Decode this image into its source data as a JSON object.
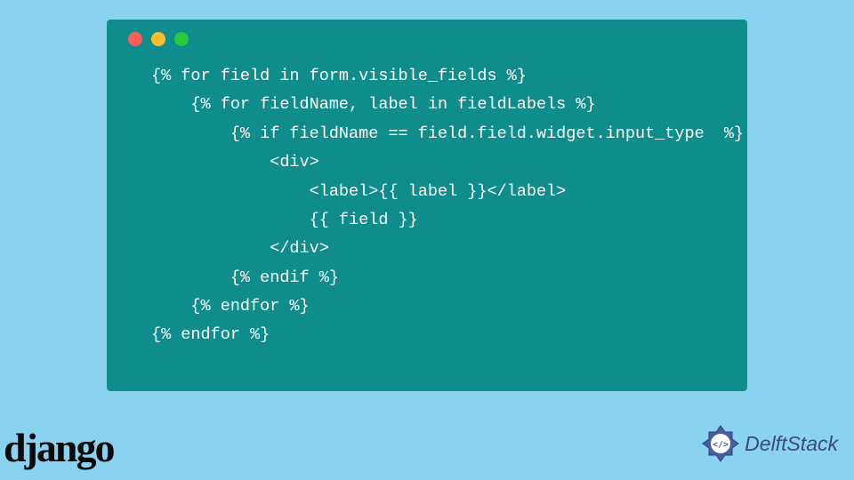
{
  "code": {
    "line1": "{% for field in form.visible_fields %}",
    "line2": "    {% for fieldName, label in fieldLabels %}",
    "line3": "        {% if fieldName == field.field.widget.input_type  %}",
    "line4": "            <div>",
    "line5": "                <label>{{ label }}</label>",
    "line6": "                {{ field }}",
    "line7": "            </div>",
    "line8": "        {% endif %}",
    "line9": "    {% endfor %}",
    "line10": "{% endfor %}"
  },
  "logos": {
    "django": "django",
    "delftstack": "DelftStack"
  },
  "window": {
    "dots": [
      "red",
      "yellow",
      "green"
    ]
  }
}
